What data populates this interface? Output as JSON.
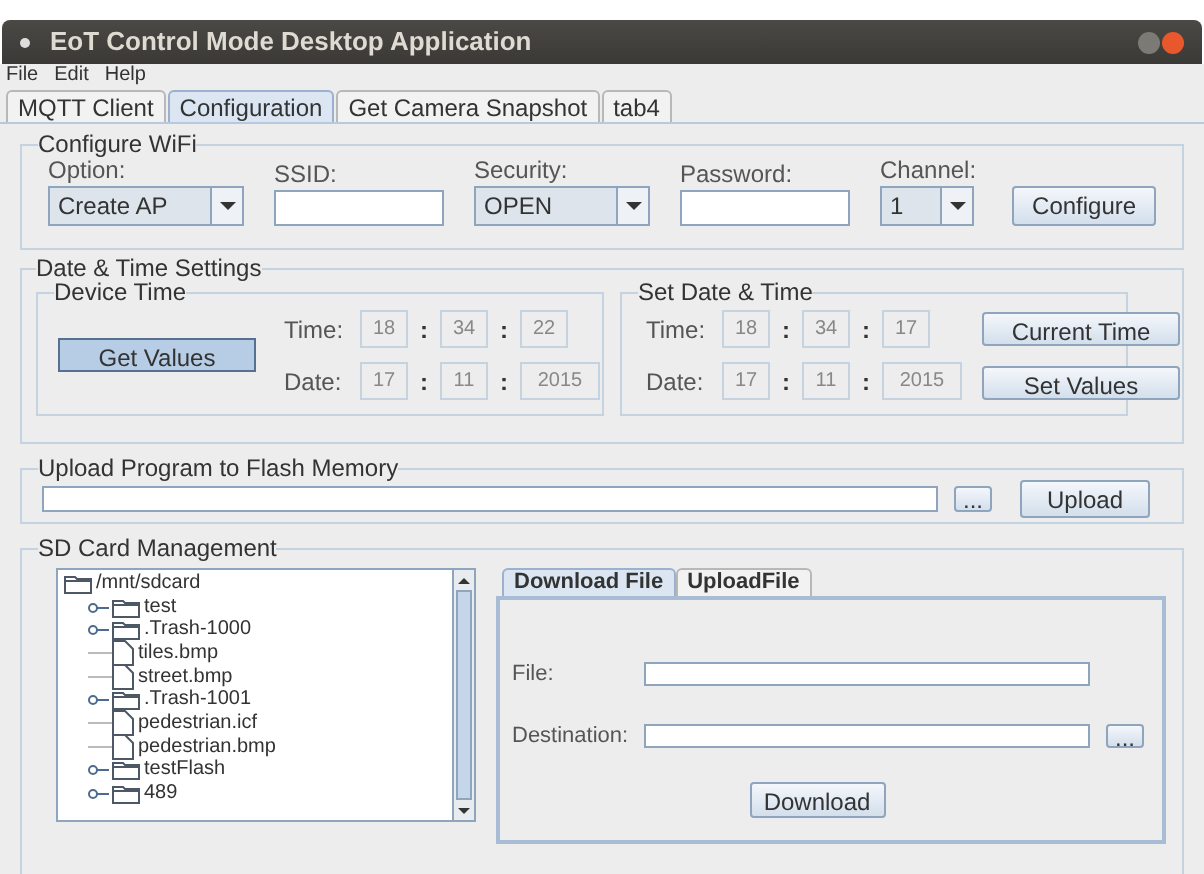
{
  "window": {
    "title": "EoT Control Mode Desktop Application"
  },
  "menu": [
    "File",
    "Edit",
    "Help"
  ],
  "tabs": [
    {
      "label": "MQTT Client",
      "selected": false
    },
    {
      "label": "Configuration",
      "selected": true
    },
    {
      "label": "Get Camera Snapshot",
      "selected": false
    },
    {
      "label": "tab4",
      "selected": false
    }
  ],
  "wifi": {
    "title": "Configure WiFi",
    "option": {
      "label": "Option:",
      "value": "Create AP"
    },
    "ssid": {
      "label": "SSID:"
    },
    "security": {
      "label": "Security:",
      "value": "OPEN"
    },
    "password": {
      "label": "Password:"
    },
    "channel": {
      "label": "Channel:",
      "value": "1"
    },
    "button": "Configure"
  },
  "datetime": {
    "title": "Date & Time Settings",
    "device": {
      "title": "Device Time",
      "button": "Get Values",
      "button_pressed": true,
      "time_label": "Time:",
      "time": [
        "18",
        "34",
        "22"
      ],
      "date_label": "Date:",
      "date": [
        "17",
        "11",
        "2015"
      ]
    },
    "set": {
      "title": "Set Date & Time",
      "time_label": "Time:",
      "time": [
        "18",
        "34",
        "17"
      ],
      "date_label": "Date:",
      "date": [
        "17",
        "11",
        "2015"
      ],
      "buttons": [
        "Current Time",
        "Set Values"
      ]
    },
    "separator": ":"
  },
  "upload": {
    "title": "Upload Program to Flash Memory",
    "browse": "...",
    "button": "Upload"
  },
  "sd": {
    "title": "SD Card Management",
    "tree": [
      {
        "label": "/mnt/sdcard",
        "kind": "folder",
        "children": [
          {
            "label": "test",
            "kind": "folder",
            "expanded": false
          },
          {
            "label": ".Trash-1000",
            "kind": "folder",
            "expanded": false
          },
          {
            "label": "tiles.bmp",
            "kind": "file"
          },
          {
            "label": "street.bmp",
            "kind": "file"
          },
          {
            "label": ".Trash-1001",
            "kind": "folder",
            "expanded": false
          },
          {
            "label": "pedestrian.icf",
            "kind": "file"
          },
          {
            "label": "pedestrian.bmp",
            "kind": "file"
          },
          {
            "label": "testFlash",
            "kind": "folder",
            "expanded": false
          },
          {
            "label": "489",
            "kind": "folder",
            "expanded": false
          }
        ]
      }
    ],
    "tabs": [
      {
        "label": "Download File",
        "selected": true
      },
      {
        "label": "UploadFile",
        "selected": false
      }
    ],
    "file_label": "File:",
    "destination_label": "Destination:",
    "browse": "...",
    "button": "Download"
  }
}
